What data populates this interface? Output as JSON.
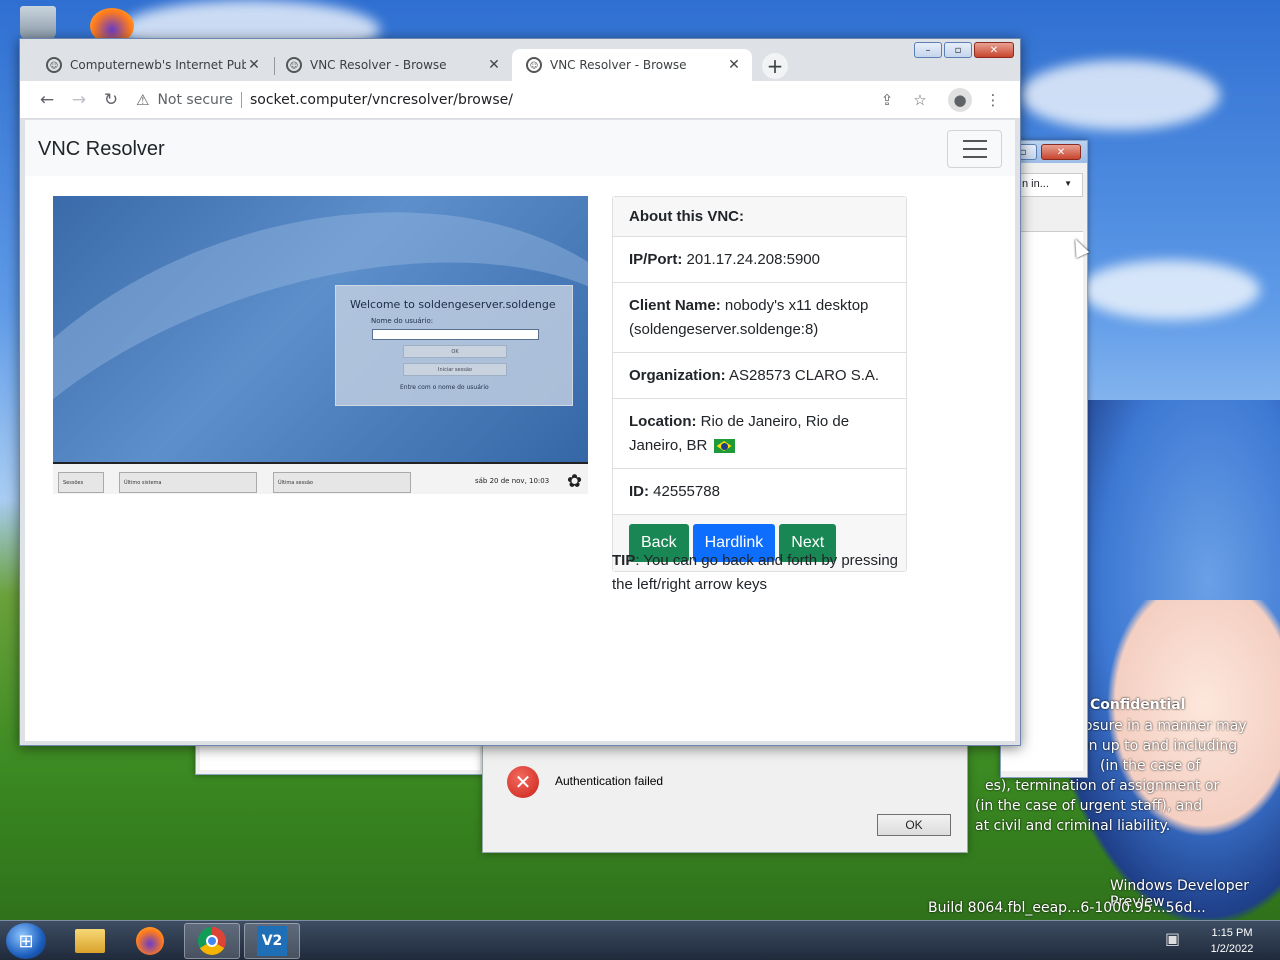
{
  "browser": {
    "tabs": [
      {
        "title": "Computernewb's Internet Pub H",
        "close": "✕"
      },
      {
        "title": "VNC Resolver - Browse",
        "close": "✕"
      },
      {
        "title": "VNC Resolver - Browse",
        "close": "✕"
      }
    ],
    "new_tab": "+",
    "security_label": "Not secure",
    "url": "socket.computer/vncresolver/browse/"
  },
  "page": {
    "brand": "VNC Resolver",
    "screenshot": {
      "welcome": "Welcome to soldengeserver.soldenge",
      "username_label": "Nome do usuário:",
      "ok_button": "OK",
      "cancel_button": "Iniciar sessão",
      "footer": "Entre com o nome do usuário",
      "session_button": "Sessões",
      "last_system": "Último sistema",
      "last_session": "Última sessão",
      "clock": "sáb 20 de nov, 10:03"
    },
    "card": {
      "header": "About this VNC:",
      "ip_label": "IP/Port:",
      "ip_value": "201.17.24.208:5900",
      "client_label": "Client Name:",
      "client_value": "nobody's x11 desktop (soldengeserver.soldenge:8)",
      "org_label": "Organization:",
      "org_value": "AS28573 CLARO S.A.",
      "location_label": "Location:",
      "location_value": "Rio de Janeiro, Rio de Janeiro, BR",
      "id_label": "ID:",
      "id_value": "42555788",
      "back": "Back",
      "hardlink": "Hardlink",
      "next": "Next"
    },
    "tip_label": "TIP",
    "tip_text": ": You can go back and forth by pressing the left/right arrow keys"
  },
  "dialog": {
    "message": "Authentication failed",
    "ok": "OK"
  },
  "background_window": {
    "dropdown": "n in..."
  },
  "desktop_text": {
    "confidential": "Confidential",
    "line1": "losure in a manner may",
    "line2": "on up to and including",
    "line3": "(in the case of",
    "line4": "es), termination of assignment or",
    "line5": "(in the case of urgent staff), and",
    "line6": "at civil and criminal liability.",
    "build1": "Windows Developer Preview",
    "build2": "Build 8064.fbl_eeap...6-1000.95...56d..."
  },
  "taskbar": {
    "time": "1:15 PM",
    "date": "1/2/2022"
  },
  "colors": {
    "green": "#198754",
    "blue": "#0d6efd"
  }
}
